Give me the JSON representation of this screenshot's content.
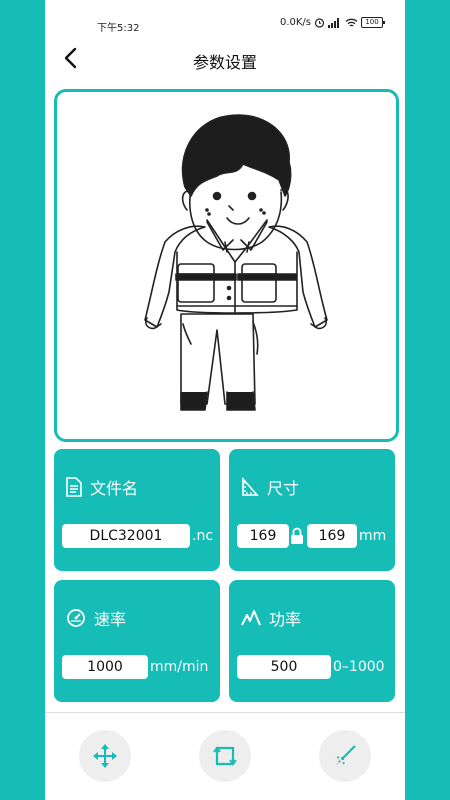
{
  "status": {
    "time": "下午5:32",
    "net_speed": "0.0K/s",
    "battery": "100"
  },
  "header": {
    "title": "参数设置"
  },
  "preview": {
    "image_alt": "line drawing of a boy"
  },
  "file": {
    "label": "文件名",
    "value": "DLC32001",
    "extension": ".nc"
  },
  "size": {
    "label": "尺寸",
    "width": "169",
    "height": "169",
    "unit": "mm"
  },
  "speed": {
    "label": "速率",
    "value": "1000",
    "unit": "mm/min"
  },
  "power": {
    "label": "功率",
    "value": "500",
    "range": "0–1000"
  },
  "toolbar": {
    "tools": [
      "move-icon",
      "rotate-icon",
      "laser-icon"
    ]
  },
  "colors": {
    "accent": "#16bdb7"
  }
}
